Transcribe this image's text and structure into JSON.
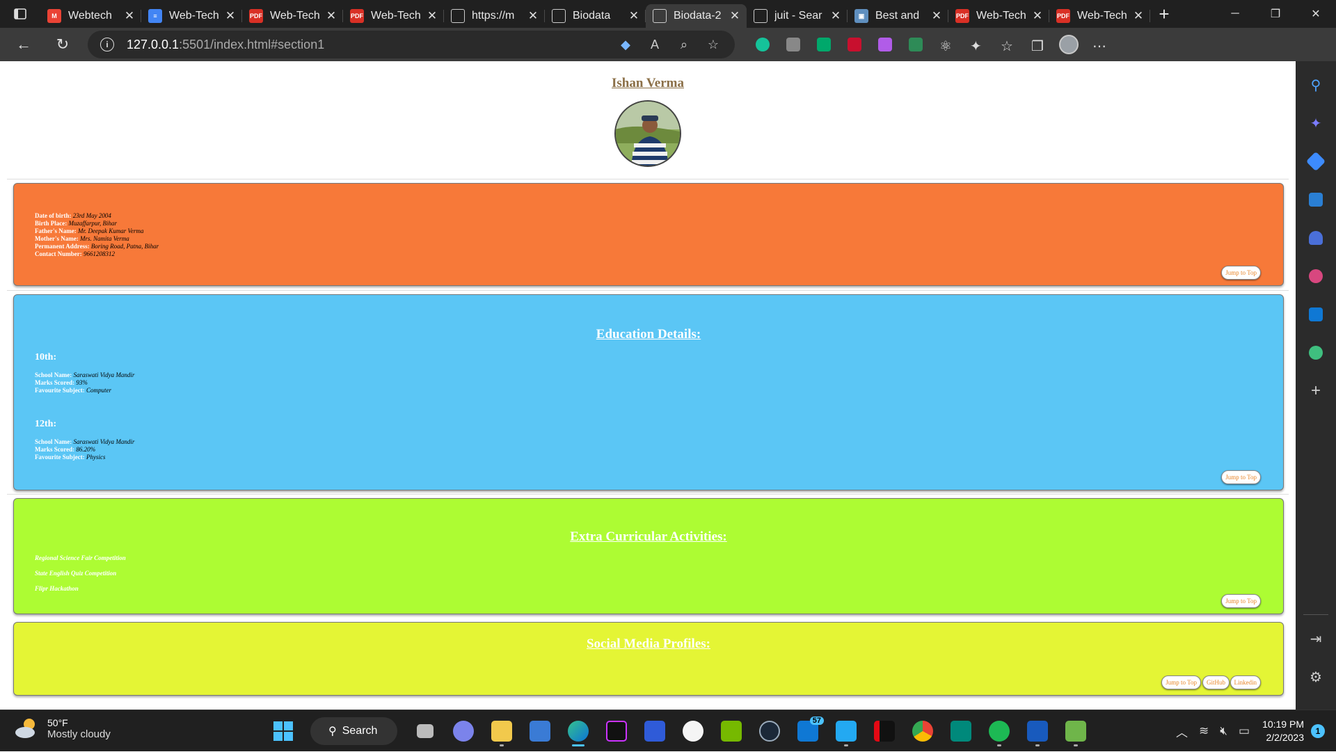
{
  "browser": {
    "tabs": [
      {
        "title": "Webtech",
        "fav_color": "#ea4335",
        "fav_glyph": "M"
      },
      {
        "title": "Web-Tech",
        "fav_color": "#4285f4",
        "fav_glyph": "≡"
      },
      {
        "title": "Web-Tech",
        "fav_color": "#d93025",
        "fav_glyph": "PDF"
      },
      {
        "title": "Web-Tech",
        "fav_color": "#d93025",
        "fav_glyph": "PDF"
      },
      {
        "title": "https://m",
        "fav_color": "#3b3b3b",
        "fav_glyph": ""
      },
      {
        "title": "Biodata",
        "fav_color": "#3b3b3b",
        "fav_glyph": ""
      },
      {
        "title": "Biodata-2",
        "fav_color": "#3b3b3b",
        "fav_glyph": "",
        "active": true
      },
      {
        "title": "juit - Sear",
        "fav_color": "#3b3b3b",
        "fav_glyph": ""
      },
      {
        "title": "Best and",
        "fav_color": "#5f8fbf",
        "fav_glyph": "▣"
      },
      {
        "title": "Web-Tech",
        "fav_color": "#d93025",
        "fav_glyph": "PDF"
      },
      {
        "title": "Web-Tech",
        "fav_color": "#d93025",
        "fav_glyph": "PDF"
      }
    ],
    "address": {
      "host": "127.0.0.1",
      "path": ":5501/index.html#section1"
    }
  },
  "page": {
    "name": "Ishan Verma",
    "personal": [
      {
        "label": "Date of birth:",
        "value": "23rd May 2004"
      },
      {
        "label": "Birth Place:",
        "value": "Muzaffarpur, Bihar"
      },
      {
        "label": "Father's Name:",
        "value": "Mr. Deepak Kumar Verma"
      },
      {
        "label": "Mother's Name:",
        "value": "Mrs. Namita Verma"
      },
      {
        "label": "Permanent Address:",
        "value": "Boring Road, Patna, Bihar"
      },
      {
        "label": "Contact Number:",
        "value": "9661208312"
      }
    ],
    "education": {
      "title": "Education Details:",
      "tenth": {
        "heading": "10th:",
        "rows": [
          {
            "label": "School Name:",
            "value": "Saraswati Vidya Mandir"
          },
          {
            "label": "Marks Scored:",
            "value": "93%"
          },
          {
            "label": "Favourite Subject:",
            "value": "Computer"
          }
        ]
      },
      "twelfth": {
        "heading": "12th:",
        "rows": [
          {
            "label": "School Name:",
            "value": "Saraswati Vidya Mandir"
          },
          {
            "label": "Marks Scored:",
            "value": "86.20%"
          },
          {
            "label": "Favourite Subject:",
            "value": "Physics"
          }
        ]
      }
    },
    "extra": {
      "title": "Extra Curricular Activities:",
      "items": [
        "Regional Science Fair Competition",
        "State English Quiz Competition",
        "Flipr Hackathon"
      ]
    },
    "social": {
      "title": "Social Media Profiles:",
      "github": "GitHub",
      "linkedin": "Linkedin"
    },
    "jump_to_top": "Jump to Top",
    "colors": {
      "personal": "#f77939",
      "education": "#5bc6f5",
      "extra": "#adfc33",
      "social": "#e4f535",
      "accent": "#e8862a"
    }
  },
  "taskbar": {
    "weather_temp": "50°F",
    "weather_desc": "Mostly cloudy",
    "search": "Search",
    "mail_badge": "57",
    "time": "10:19 PM",
    "date": "2/2/2023",
    "notifications": "1"
  }
}
